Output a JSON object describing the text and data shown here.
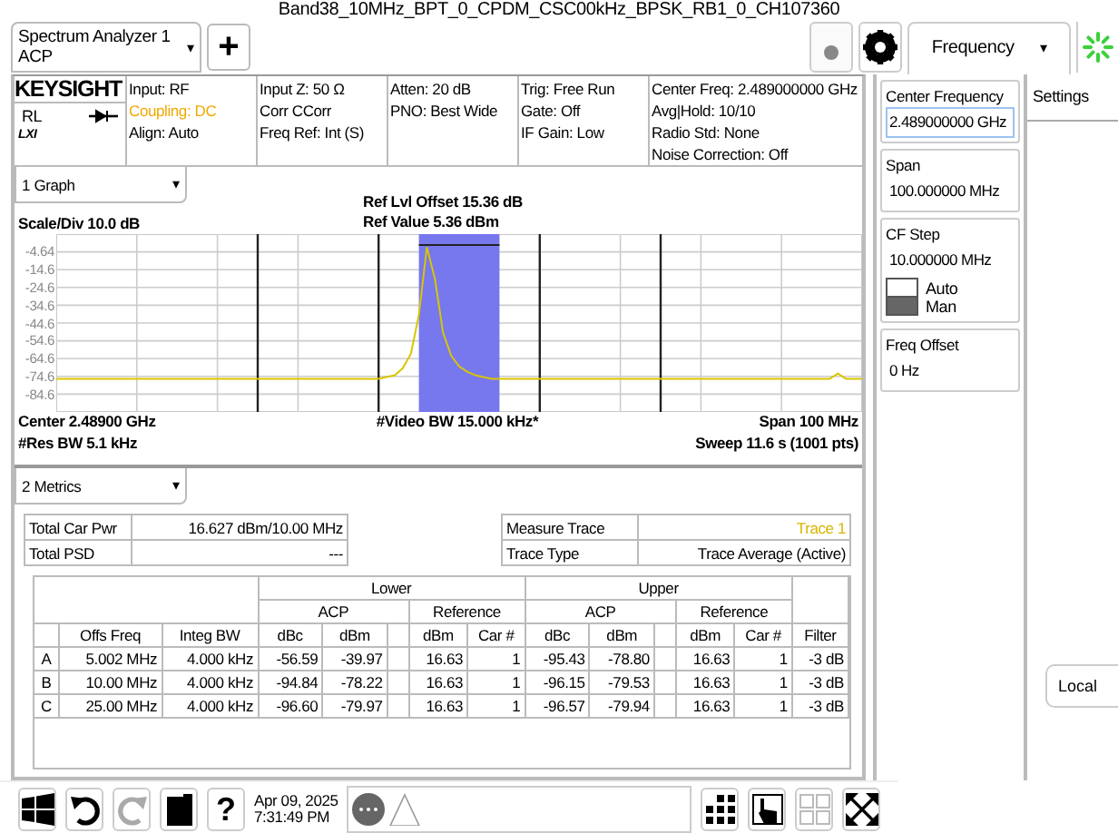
{
  "window": {
    "title": "Band38_10MHz_BPT_0_CPDM_CSC00kHz_BPSK_RB1_0_CH107360"
  },
  "screen_selector": {
    "lines": [
      "Spectrum Analyzer 1",
      "ACP"
    ],
    "caret": "▾"
  },
  "add_button": "+",
  "menu_selector": {
    "label": "Frequency",
    "caret": "▾"
  },
  "header": {
    "logo": "KEYSIGHT",
    "status": "RL",
    "lxi": "LXI",
    "columns": [
      [
        {
          "text": "Input: RF",
          "highlighted": false
        },
        {
          "text": "Coupling: DC",
          "highlighted": true
        },
        {
          "text": "Align: Auto",
          "highlighted": false
        }
      ],
      [
        {
          "text": "Input Z: 50 Ω",
          "highlighted": false
        },
        {
          "text": "Corr CCorr",
          "highlighted": false
        },
        {
          "text": "Freq Ref: Int (S)",
          "highlighted": false
        }
      ],
      [
        {
          "text": "Atten: 20 dB",
          "highlighted": false
        },
        {
          "text": "PNO: Best Wide",
          "highlighted": false
        }
      ],
      [
        {
          "text": "Trig: Free Run",
          "highlighted": false
        },
        {
          "text": "Gate: Off",
          "highlighted": false
        },
        {
          "text": "IF Gain: Low",
          "highlighted": false
        }
      ],
      [
        {
          "text": "Center Freq: 2.489000000 GHz",
          "highlighted": false
        },
        {
          "text": "Avg|Hold: 10/10",
          "highlighted": false
        },
        {
          "text": "Radio Std: None",
          "highlighted": false
        },
        {
          "text": "Noise Correction: Off",
          "highlighted": false
        }
      ]
    ]
  },
  "graph_selector": {
    "label": "1 Graph",
    "caret": "▾"
  },
  "graph": {
    "scale": "Scale/Div 10.0 dB",
    "ref_offset": "Ref Lvl Offset 15.36 dB",
    "ref_value": "Ref Value 5.36 dBm",
    "chart_data": {
      "type": "line",
      "grid": true,
      "ylim": [
        -94.64,
        5.36
      ],
      "yticks": [
        {
          "value": -4.64,
          "label": "-4.64"
        },
        {
          "value": -14.64,
          "label": "-14.6"
        },
        {
          "value": -24.64,
          "label": "-24.6"
        },
        {
          "value": -34.64,
          "label": "-34.6"
        },
        {
          "value": -44.64,
          "label": "-44.6"
        },
        {
          "value": -54.64,
          "label": "-54.6"
        },
        {
          "value": -64.64,
          "label": "-64.6"
        },
        {
          "value": -74.64,
          "label": "-74.6"
        },
        {
          "value": -84.64,
          "label": "-84.6"
        }
      ],
      "categories": [
        null,
        null,
        null,
        null,
        null,
        null,
        null,
        null,
        null,
        null,
        null,
        null,
        null,
        null,
        null,
        null,
        null,
        null,
        null,
        null,
        null,
        null,
        null,
        null,
        null,
        null,
        null,
        null,
        null,
        null,
        null,
        null,
        null,
        null,
        null,
        null,
        null,
        null,
        null,
        null,
        null,
        null,
        null,
        null,
        null,
        null,
        null,
        null,
        null,
        null,
        null,
        null,
        null,
        null,
        null,
        null,
        null,
        null,
        null,
        null,
        null,
        null,
        null,
        null,
        null,
        null,
        null,
        null,
        null,
        null,
        null,
        null,
        null,
        null,
        null,
        null,
        null,
        null,
        null,
        null,
        null,
        null,
        null,
        null,
        null,
        null,
        null,
        null,
        null,
        null,
        null,
        null,
        null,
        null,
        null,
        null,
        null,
        null,
        null,
        null,
        null
      ],
      "series": [
        {
          "color": "#d9c500",
          "values": [
            -76,
            -76,
            -76,
            -76,
            -76,
            -76,
            -76,
            -76,
            -76,
            -76,
            -76,
            -76,
            -76,
            -76,
            -76,
            -76,
            -76,
            -76,
            -76,
            -76,
            -76,
            -76,
            -76,
            -76,
            -76,
            -76,
            -76,
            -76,
            -76,
            -76,
            -76,
            -76,
            -76,
            -76,
            -76,
            -76,
            -76,
            -76,
            -76,
            -76,
            -76,
            -75,
            -74,
            -70,
            -62,
            -40,
            -2,
            -20,
            -50,
            -63,
            -69,
            -72,
            -74,
            -75,
            -76,
            -76,
            -76,
            -76,
            -76,
            -76,
            -76,
            -76,
            -76,
            -76,
            -76,
            -76,
            -76,
            -76,
            -76,
            -76,
            -76,
            -76,
            -76,
            -76,
            -76,
            -76,
            -76,
            -76,
            -76,
            -76,
            -76,
            -76,
            -76,
            -76,
            -76,
            -76,
            -76,
            -76,
            -76,
            -76,
            -76,
            -76,
            -76,
            -76,
            -76,
            -76,
            -76,
            -73,
            -76,
            -76,
            -76
          ]
        }
      ]
    },
    "center": "Center 2.48900 GHz",
    "video_bw": "#Video BW 15.000 kHz*",
    "span": "Span 100 MHz",
    "res_bw": "#Res BW 5.1 kHz",
    "sweep": "Sweep 11.6 s (1001 pts)"
  },
  "metrics_selector": {
    "label": "2 Metrics",
    "caret": "▾"
  },
  "summary_left": [
    {
      "label": "Total Car Pwr",
      "value": "16.627 dBm/10.00 MHz",
      "highlighted": false
    },
    {
      "label": "Total PSD",
      "value": "---",
      "highlighted": false
    }
  ],
  "summary_right": [
    {
      "label": "Measure Trace",
      "value": "Trace 1",
      "highlighted": true
    },
    {
      "label": "Trace Type",
      "value": "Trace Average (Active)",
      "highlighted": false
    }
  ],
  "acp_table": {
    "groups": [
      {
        "label": "Lower",
        "subgroups": [
          "ACP",
          "Reference"
        ]
      },
      {
        "label": "Upper",
        "subgroups": [
          "ACP",
          "Reference"
        ]
      }
    ],
    "columns": [
      "",
      "Offs Freq",
      "Integ BW",
      "dBc",
      "dBm",
      "",
      "dBm",
      "Car #",
      "dBc",
      "dBm",
      "",
      "dBm",
      "Car #",
      "Filter"
    ],
    "rows": [
      [
        "A",
        "5.002 MHz",
        "4.000 kHz",
        "-56.59",
        "-39.97",
        "",
        "16.63",
        "1",
        "-95.43",
        "-78.80",
        "",
        "16.63",
        "1",
        "-3 dB"
      ],
      [
        "B",
        "10.00 MHz",
        "4.000 kHz",
        "-94.84",
        "-78.22",
        "",
        "16.63",
        "1",
        "-96.15",
        "-79.53",
        "",
        "16.63",
        "1",
        "-3 dB"
      ],
      [
        "C",
        "25.00 MHz",
        "4.000 kHz",
        "-96.60",
        "-79.97",
        "",
        "16.63",
        "1",
        "-96.57",
        "-79.94",
        "",
        "16.63",
        "1",
        "-3 dB"
      ]
    ]
  },
  "menu_panel": {
    "controls": [
      {
        "kind": "field",
        "label": "Center Frequency",
        "value": "2.489000000 GHz",
        "selected": true
      },
      {
        "kind": "field",
        "label": "Span",
        "value": "100.000000 MHz",
        "selected": false
      },
      {
        "kind": "field_toggle",
        "label": "CF Step",
        "value": "10.000000 MHz",
        "selected": false,
        "options": [
          {
            "label": "Auto",
            "selected": false
          },
          {
            "label": "Man",
            "selected": true
          }
        ]
      },
      {
        "kind": "field",
        "label": "Freq Offset",
        "value": "0 Hz",
        "selected": false
      }
    ]
  },
  "settings_tab": "Settings",
  "local_button": "Local",
  "taskbar": {
    "help": "?",
    "date": "Apr 09, 2025",
    "time": "7:31:49 PM"
  }
}
